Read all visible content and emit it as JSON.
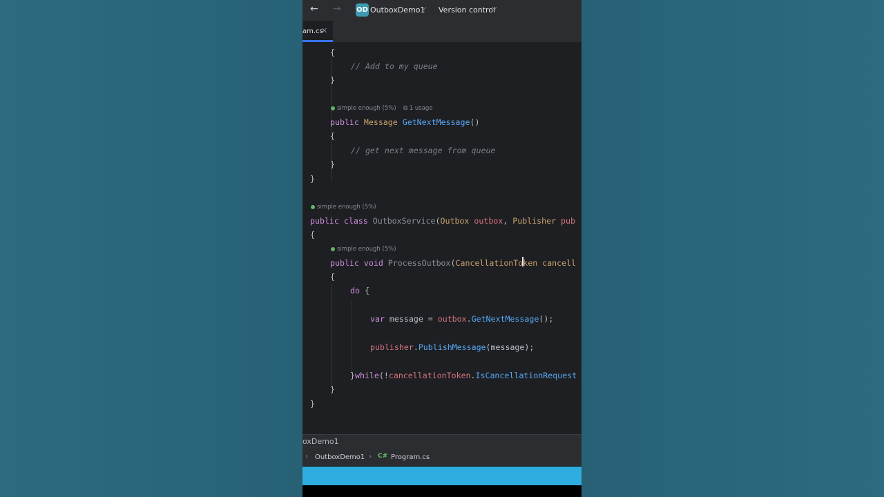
{
  "titlebar": {
    "back_icon": "←",
    "forward_icon": "→",
    "project_badge": "OD",
    "project_name": "OutboxDemo1",
    "vcs_label": "Version control",
    "chevron": "⌵"
  },
  "tab": {
    "label": "am.cs",
    "close": "✕"
  },
  "code": {
    "l1": "{",
    "l2_comment": "// Add to my queue",
    "l3": "}",
    "hint1": "simple enough (5%)",
    "hint1_usage": "1 usage",
    "l4_kw": "public",
    "l4_type": "Message",
    "l4_fn": "GetNextMessage",
    "l4_rest": "()",
    "l5": "{",
    "l6_comment": "// get next message from queue",
    "l7": "}",
    "l8": "}",
    "hint2": "simple enough (5%)",
    "l9_kw1": "public",
    "l9_kw2": "class",
    "l9_name": "OutboxService",
    "l9_p1": "(",
    "l9_t1": "Outbox",
    "l9_a1": "outbox",
    "l9_comma": ", ",
    "l9_t2": "Publisher",
    "l9_a2": "pub",
    "l10": "{",
    "hint3": "simple enough (5%)",
    "l11_kw1": "public",
    "l11_kw2": "void",
    "l11_name": "ProcessOutbox",
    "l11_p": "(",
    "l11_t": "CancellationToken",
    "l11_a": "cancell",
    "l12": "{",
    "l13_kw": "do",
    "l13_rest": " {",
    "l14_kw": "var",
    "l14_mid": " message = ",
    "l14_obj": "outbox",
    "l14_dot": ".",
    "l14_fn": "GetNextMessage",
    "l14_end": "();",
    "l15_obj": "publisher",
    "l15_dot": ".",
    "l15_fn": "PublishMessage",
    "l15_end": "(message);",
    "l16_brace": "}",
    "l16_kw": "while",
    "l16_p": "(!",
    "l16_obj": "cancellationToken",
    "l16_dot": ".",
    "l16_prop": "IsCancellationRequest",
    "l17": "}",
    "l18": "}"
  },
  "statusbar": {
    "project": "oxDemo1"
  },
  "breadcrumbs": {
    "arrow": "›",
    "project": "OutboxDemo1",
    "sep": "›",
    "file_icon": "C#",
    "file": "Program.cs"
  },
  "colors": {
    "background": "#2a6579",
    "editor": "#1e1f22",
    "keyword": "#cf8ee0",
    "type": "#c9a26d",
    "function": "#56a8f5",
    "taskbar": "#2eaee0"
  }
}
